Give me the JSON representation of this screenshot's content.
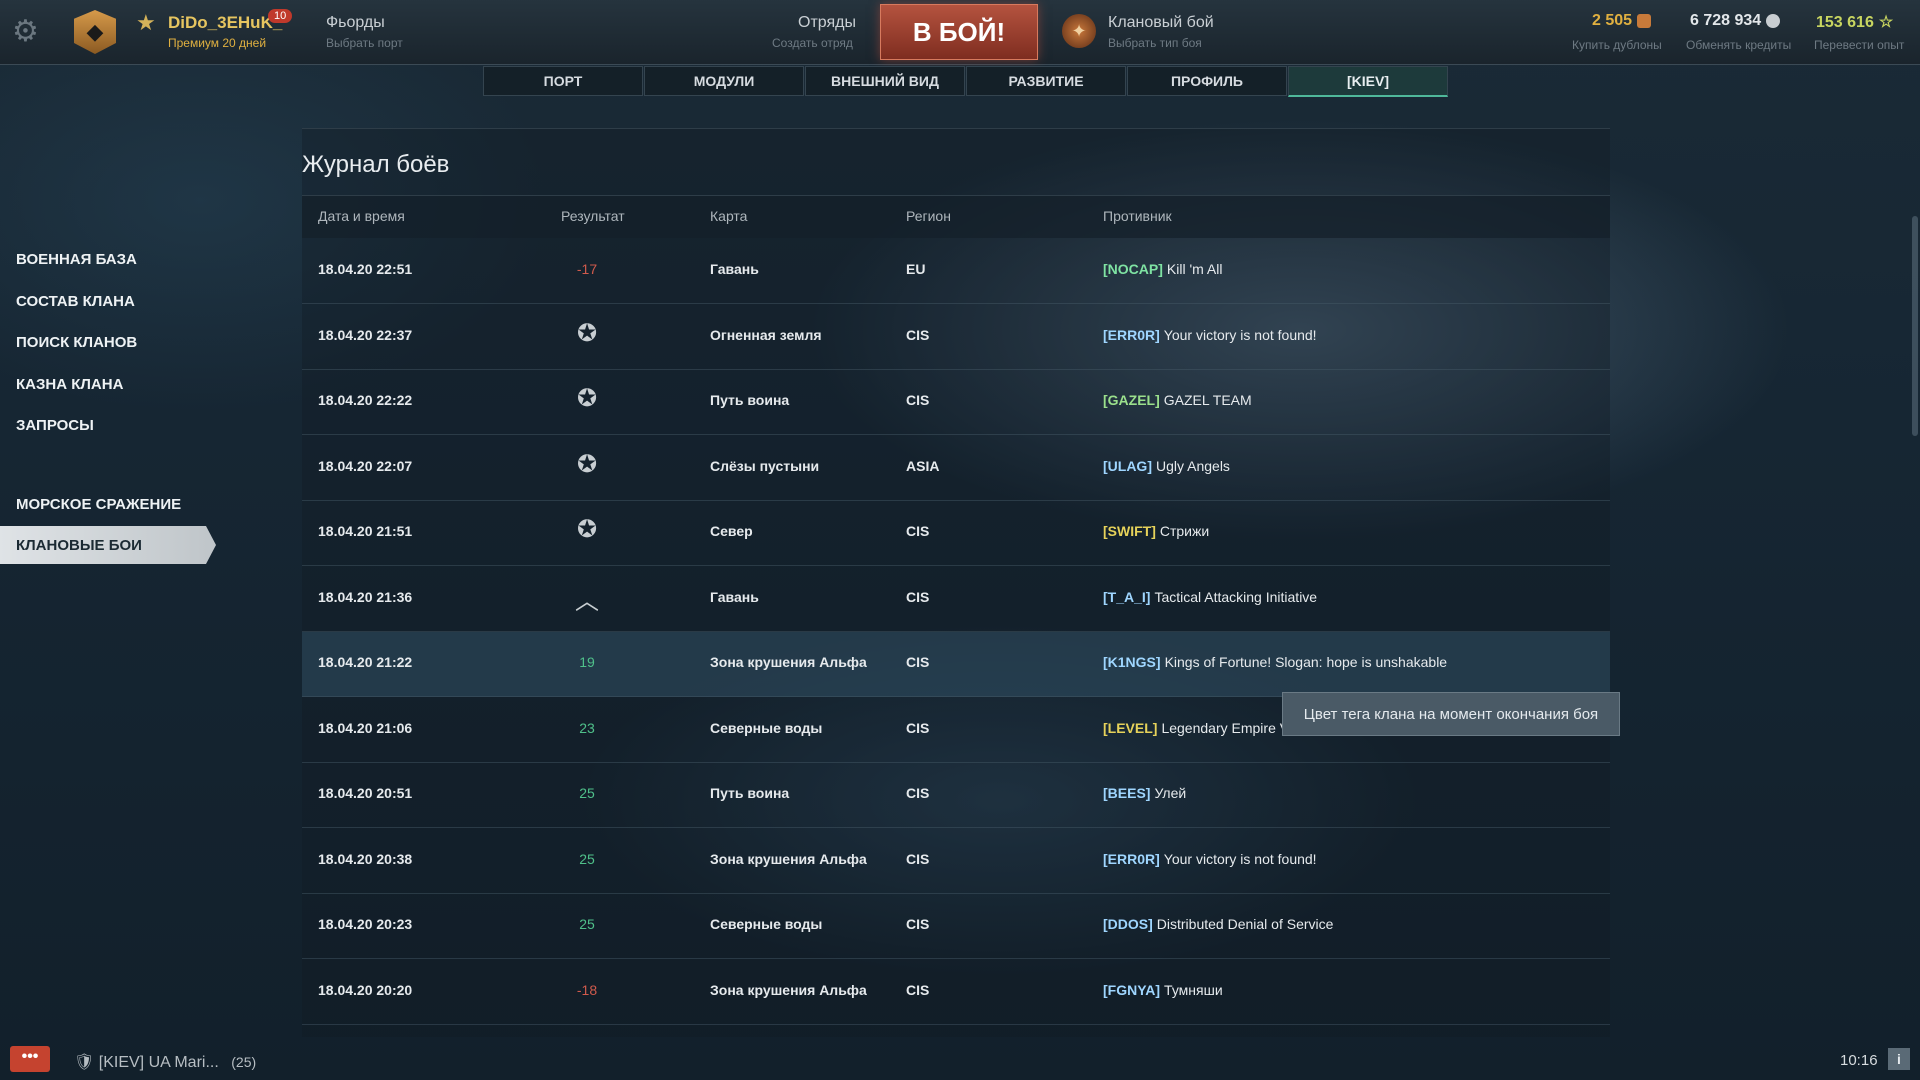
{
  "topbar": {
    "player_name": "DiDo_3EHuK_",
    "badge_count": "10",
    "premium": "Премиум 20 дней",
    "port_title": "Фьорды",
    "port_sub": "Выбрать порт",
    "squad_title": "Отряды",
    "squad_sub": "Создать отряд",
    "battle_button": "В БОЙ!",
    "clan_battle_title": "Клановый бой",
    "clan_battle_sub": "Выбрать тип боя",
    "doubloons": "2 505",
    "doubloons_sub": "Купить дублоны",
    "credits": "6 728 934",
    "credits_sub": "Обменять кредиты",
    "free_xp": "153 616",
    "free_xp_sub": "Перевести опыт"
  },
  "tabs": [
    "ПОРТ",
    "МОДУЛИ",
    "ВНЕШНИЙ ВИД",
    "РАЗВИТИЕ",
    "ПРОФИЛЬ",
    "[KIEV]"
  ],
  "sidebar": [
    "ВОЕННАЯ БАЗА",
    "СОСТАВ КЛАНА",
    "ПОИСК КЛАНОВ",
    "КАЗНА КЛАНА",
    "ЗАПРОСЫ",
    "МОРСКОЕ СРАЖЕНИЕ",
    "КЛАНОВЫЕ БОИ"
  ],
  "page_title": "Журнал боёв",
  "columns": [
    "Дата и время",
    "Результат",
    "Карта",
    "Регион",
    "Противник"
  ],
  "rows": [
    {
      "date": "18.04.20 22:51",
      "result": "-17",
      "result_kind": "neg",
      "map": "Гавань",
      "region": "EU",
      "tag": "[NOCAP]",
      "tag_color": "#7fe3a3",
      "name": "Kill 'm All"
    },
    {
      "date": "18.04.20 22:37",
      "result": "",
      "result_kind": "star",
      "result_icon": "promotion-star-icon",
      "map": "Огненная земля",
      "region": "CIS",
      "tag": "[ERR0R]",
      "tag_color": "#9fd6ff",
      "name": "Your victory is not found!"
    },
    {
      "date": "18.04.20 22:22",
      "result": "",
      "result_kind": "star",
      "result_icon": "promotion-star-icon",
      "map": "Путь воина",
      "region": "CIS",
      "tag": "[GAZEL]",
      "tag_color": "#9be08c",
      "name": "GAZEL TEAM"
    },
    {
      "date": "18.04.20 22:07",
      "result": "",
      "result_kind": "star",
      "result_icon": "promotion-star-icon",
      "map": "Слёзы пустыни",
      "region": "ASIA",
      "tag": "[ULAG]",
      "tag_color": "#9fd6ff",
      "name": "Ugly Angels"
    },
    {
      "date": "18.04.20 21:51",
      "result": "",
      "result_kind": "star",
      "result_icon": "promotion-star-icon",
      "map": "Север",
      "region": "CIS",
      "tag": "[SWIFT]",
      "tag_color": "#e6d25a",
      "name": "Стрижи"
    },
    {
      "date": "18.04.20 21:36",
      "result": "",
      "result_kind": "chevron",
      "result_icon": "chevron-up-icon",
      "map": "Гавань",
      "region": "CIS",
      "tag": "[T_A_I]",
      "tag_color": "#9fd6ff",
      "name": "Tactical Attacking Initiative"
    },
    {
      "date": "18.04.20 21:22",
      "result": "19",
      "result_kind": "pos",
      "map": "Зона крушения Альфа",
      "region": "CIS",
      "tag": "[K1NGS]",
      "tag_color": "#9fd6ff",
      "name": "Kings of Fortune! Slogan: hope is unshakable",
      "highlight": true
    },
    {
      "date": "18.04.20 21:06",
      "result": "23",
      "result_kind": "pos",
      "map": "Северные воды",
      "region": "CIS",
      "tag": "[LEVEL]",
      "tag_color": "#e6d25a",
      "name": "Legendary Empire V"
    },
    {
      "date": "18.04.20 20:51",
      "result": "25",
      "result_kind": "pos",
      "map": "Путь воина",
      "region": "CIS",
      "tag": "[BEES]",
      "tag_color": "#9fd6ff",
      "name": "Улей"
    },
    {
      "date": "18.04.20 20:38",
      "result": "25",
      "result_kind": "pos",
      "map": "Зона крушения Альфа",
      "region": "CIS",
      "tag": "[ERR0R]",
      "tag_color": "#9fd6ff",
      "name": "Your victory is not found!"
    },
    {
      "date": "18.04.20 20:23",
      "result": "25",
      "result_kind": "pos",
      "map": "Северные воды",
      "region": "CIS",
      "tag": "[DDOS]",
      "tag_color": "#9fd6ff",
      "name": "Distributed Denial of Service"
    },
    {
      "date": "18.04.20 20:20",
      "result": "-18",
      "result_kind": "neg",
      "map": "Зона крушения Альфа",
      "region": "CIS",
      "tag": "[FGNYA]",
      "tag_color": "#9fd6ff",
      "name": "Тумняши"
    }
  ],
  "tooltip": "Цвет тега клана на момент окончания боя",
  "bottom": {
    "chat_button": "•••",
    "chat_label": "[KIEV] UA Mari...",
    "chat_count": "(25)",
    "clock": "10:16",
    "info_button": "i"
  },
  "colors": {
    "accent_green": "#4fc08a",
    "negative_red": "#d05a4c",
    "battle_button": "#b5533f",
    "gold": "#e6c560"
  }
}
